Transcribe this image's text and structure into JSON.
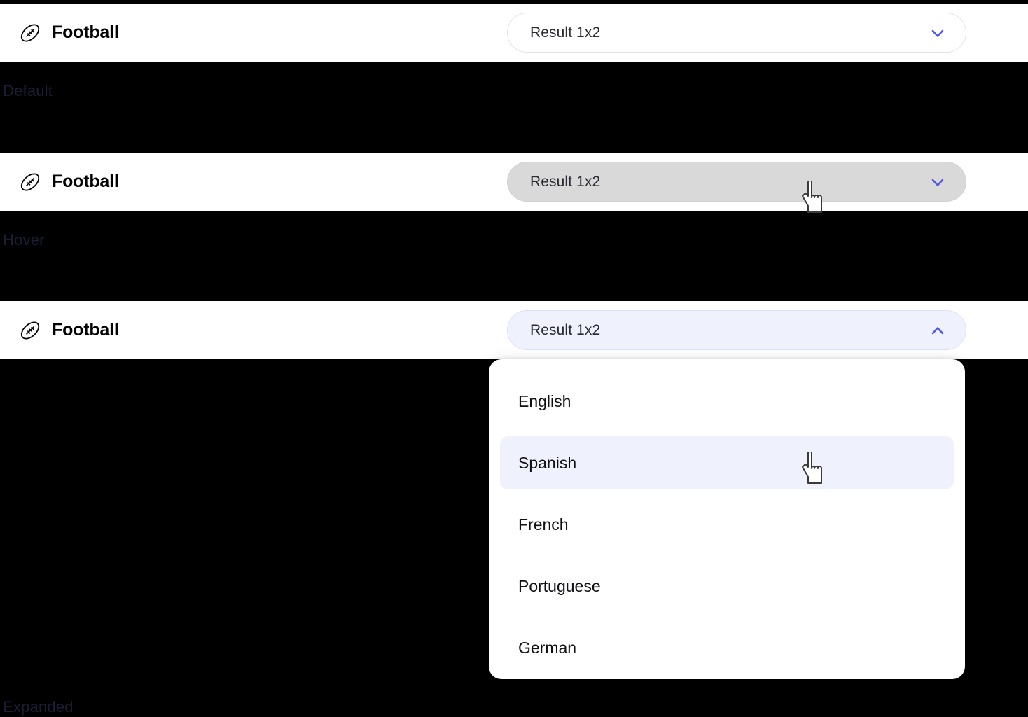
{
  "states": [
    {
      "caption": "Default",
      "sport_label": "Football",
      "sport_icon": "football-icon",
      "dropdown": {
        "value": "Result 1x2",
        "chevron_icon": "chevron-down-icon",
        "state": "default"
      }
    },
    {
      "caption": "Hover",
      "sport_label": "Football",
      "sport_icon": "football-icon",
      "dropdown": {
        "value": "Result 1x2",
        "chevron_icon": "chevron-down-icon",
        "state": "hover"
      }
    },
    {
      "caption": "Expanded",
      "sport_label": "Football",
      "sport_icon": "football-icon",
      "dropdown": {
        "value": "Result 1x2",
        "chevron_icon": "chevron-up-icon",
        "state": "expanded"
      }
    }
  ],
  "menu": {
    "items": [
      {
        "label": "English",
        "highlighted": false
      },
      {
        "label": "Spanish",
        "highlighted": true
      },
      {
        "label": "French",
        "highlighted": false
      },
      {
        "label": "Portuguese",
        "highlighted": false
      },
      {
        "label": "German",
        "highlighted": false
      }
    ]
  },
  "cursors": [
    {
      "name": "pointer-cursor-hover-state"
    },
    {
      "name": "pointer-cursor-menu-item"
    }
  ],
  "colors": {
    "accent_blue": "#4F5BE8",
    "hover_fill": "#D9D9D9",
    "expanded_fill": "#EFF1FD",
    "border_default": "#E2E3E8",
    "caption_text": "#1C1E35",
    "background": "#000000",
    "surface": "#FFFFFF"
  }
}
